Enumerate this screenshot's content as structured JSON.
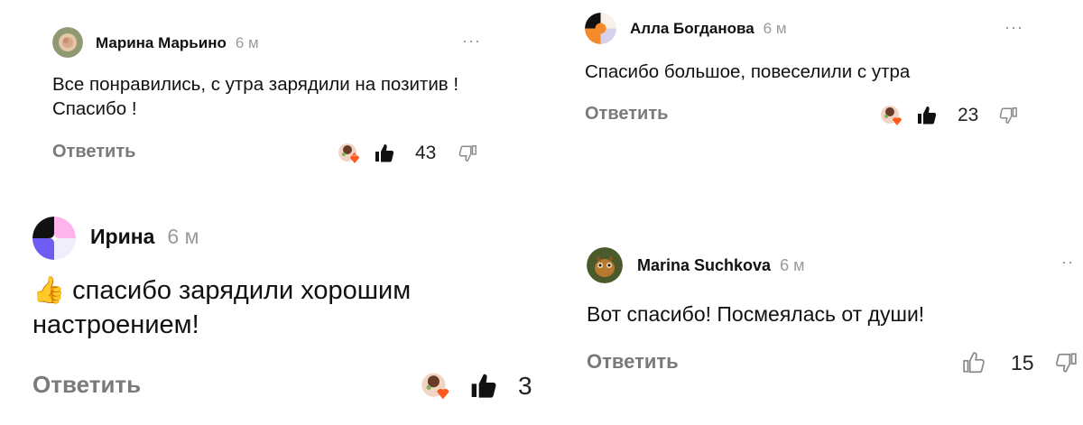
{
  "comments": [
    {
      "author": "Марина Марьино",
      "time": "6 м",
      "text": "Все понравились, с утра зарядили на позитив ! Спасибо !",
      "reply": "Ответить",
      "likes": "43",
      "more": "···",
      "avatar": "rose-photo"
    },
    {
      "author": "Алла Богданова",
      "time": "6 м",
      "text": "Спасибо большое, повеселили с утра",
      "reply": "Ответить",
      "likes": "23",
      "more": "···",
      "avatar": "abstract-orange"
    },
    {
      "author": "Ирина",
      "time": "6 м",
      "text": "спасибо зарядили хорошим настроением!",
      "emoji": "👍",
      "reply": "Ответить",
      "likes": "3",
      "avatar": "abstract-purple"
    },
    {
      "author": "Marina Suchkova",
      "time": "6 м",
      "text": "Вот спасибо! Посмеялась от души!",
      "reply": "Ответить",
      "likes": "15",
      "more": "··",
      "avatar": "animal-photo"
    }
  ],
  "colors": {
    "name": "#111111",
    "time": "#9a9a9a",
    "reply": "#7a7a7a",
    "like_fill": "#111111",
    "reaction_heart": "#ff5a1f"
  },
  "icons": [
    "thumbs-up-filled-icon",
    "thumbs-up-outline-icon",
    "thumbs-down-outline-icon",
    "reaction-avatar-icon",
    "more-icon"
  ]
}
